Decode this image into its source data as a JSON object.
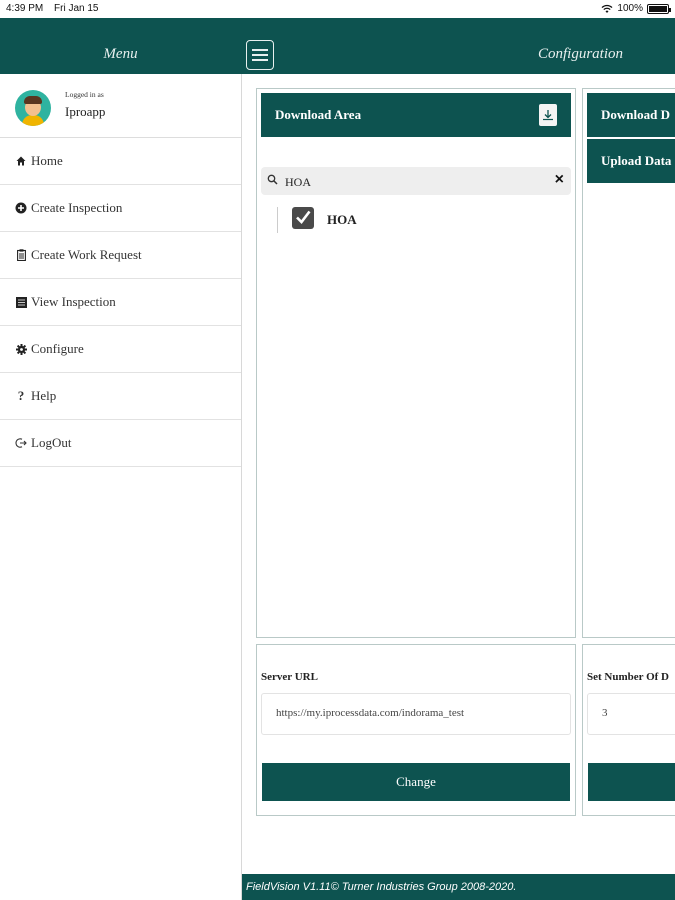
{
  "status_bar": {
    "time": "4:39 PM",
    "date": "Fri Jan 15",
    "battery": "100%"
  },
  "header": {
    "menu_title": "Menu",
    "config_title": "Configuration"
  },
  "user": {
    "logged_label": "Logged in as",
    "name": "Iproapp"
  },
  "sidebar": {
    "items": [
      {
        "label": "Home",
        "icon": "home-icon"
      },
      {
        "label": "Create Inspection",
        "icon": "plus-circle-icon"
      },
      {
        "label": "Create Work Request",
        "icon": "clipboard-icon"
      },
      {
        "label": "View Inspection",
        "icon": "list-icon"
      },
      {
        "label": "Configure",
        "icon": "gear-icon"
      },
      {
        "label": "Help",
        "icon": "question-icon"
      },
      {
        "label": "LogOut",
        "icon": "logout-icon"
      }
    ]
  },
  "download_area": {
    "title": "Download Area",
    "search_value": "HOA",
    "tree_item": "HOA",
    "tree_item_checked": true
  },
  "right_panel": {
    "download_title": "Download D",
    "upload_title": "Upload Data"
  },
  "server": {
    "label": "Server URL",
    "value": "https://my.iprocessdata.com/indorama_test",
    "button": "Change"
  },
  "set_number": {
    "label": "Set Number Of D",
    "value": "3"
  },
  "footer": {
    "text": "FieldVision V1.11© Turner Industries Group 2008-2020."
  },
  "colors": {
    "primary": "#0d5350",
    "border": "#b9c9c7"
  }
}
